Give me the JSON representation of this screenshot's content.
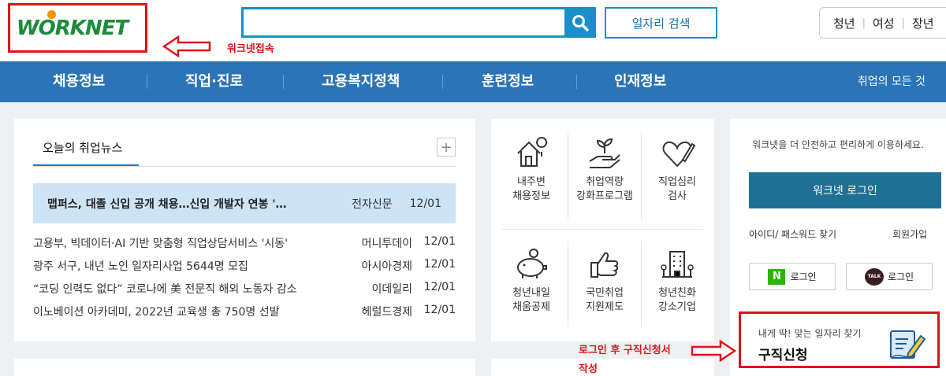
{
  "header": {
    "logo_text": "WORKNET",
    "annotation_logo": "워크넷접속",
    "search_placeholder": "",
    "job_search_label": "일자리 검색",
    "tabs": [
      "청년",
      "여성",
      "장년"
    ]
  },
  "nav": {
    "items": [
      "채용정보",
      "직업·진로",
      "고용복지정책",
      "훈련정보",
      "인재정보"
    ],
    "all_label": "취업의 모든 것"
  },
  "news": {
    "title": "오늘의 취업뉴스",
    "more_symbol": "+",
    "headline": {
      "title": "맵퍼스, 대졸 신입 공개 채용…신입 개발자 연봉 '…",
      "source": "전자신문",
      "date": "12/01"
    },
    "items": [
      {
        "title": "고용부, 빅데이터·AI 기반 맞춤형 직업상담서비스 '시동'",
        "source": "머니투데이",
        "date": "12/01"
      },
      {
        "title": "광주 서구, 내년 노인 일자리사업 5644명 모집",
        "source": "아시아경제",
        "date": "12/01"
      },
      {
        "title": "“코딩 인력도 없다” 코로나에 美 전문직 해외 노동자 감소",
        "source": "이데일리",
        "date": "12/01"
      },
      {
        "title": "이노베이션 아카데미, 2022년 교육생 총 750명 선발",
        "source": "헤럴드경제",
        "date": "12/01"
      }
    ]
  },
  "services": [
    {
      "label": "내주변\n채용정보",
      "icon": "house-location-icon"
    },
    {
      "label": "취업역량\n강화프로그램",
      "icon": "hand-sprout-icon"
    },
    {
      "label": "직업심리\n검사",
      "icon": "heart-pencil-icon"
    },
    {
      "label": "청년내일\n채움공제",
      "icon": "piggy-bank-icon"
    },
    {
      "label": "국민취업\n지원제도",
      "icon": "thumbs-up-icon"
    },
    {
      "label": "청년친화\n강소기업",
      "icon": "building-icon"
    }
  ],
  "login": {
    "info": "워크넷을 더 안전하고 편리하게 이용하세요.",
    "button": "워크넷 로그인",
    "find": "아이디/ 패스워드 찾기",
    "join": "회원가입",
    "naver_label": "로그인",
    "naver_mark": "N",
    "kakao_label": "로그인",
    "kakao_mark": "TALK"
  },
  "apply": {
    "sub": "내게 딱! 맞는 일자리 찾기",
    "main": "구직신청",
    "annotation_line1": "로그인 후 구직신청서",
    "annotation_line2": "작성"
  },
  "colors": {
    "brand_blue": "#2a74b7",
    "annotation_red": "#e0131a",
    "login_teal": "#1f7093"
  }
}
